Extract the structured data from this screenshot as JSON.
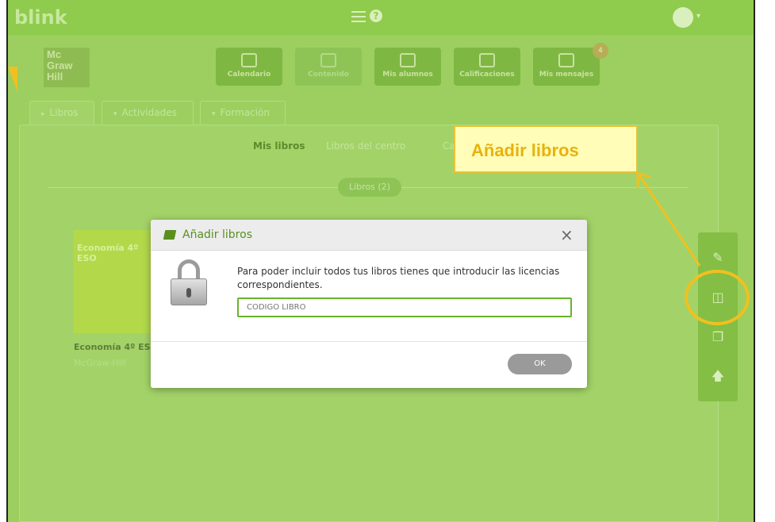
{
  "app": {
    "brand": "blink",
    "help": "?"
  },
  "logo": {
    "lines": [
      "Mc",
      "Graw",
      "Hill"
    ]
  },
  "nav": [
    {
      "label": "Calendario",
      "icon": "calendar-icon"
    },
    {
      "label": "Contenido",
      "icon": "content-icon"
    },
    {
      "label": "Mis alumnos",
      "icon": "students-icon"
    },
    {
      "label": "Calificaciones",
      "icon": "grades-icon"
    },
    {
      "label": "Mis mensajes",
      "icon": "messages-icon"
    }
  ],
  "messages_badge": "4",
  "tabs": [
    {
      "label": "Libros",
      "arrow": "▸"
    },
    {
      "label": "Actividades",
      "arrow": "▾"
    },
    {
      "label": "Formación",
      "arrow": "▾"
    }
  ],
  "subtabs": [
    "Mis libros",
    "Libros del centro",
    "Ca"
  ],
  "books_pill": "Libros (2)",
  "book": {
    "cover_text": "Economía 4º ESO",
    "title": "Economía 4º ES",
    "publisher": "McGraw-Hill"
  },
  "callout": {
    "text": "Añadir libros"
  },
  "modal": {
    "title": "Añadir libros",
    "close": "×",
    "message": "Para poder incluir todos tus libros tienes que introducir las licencias correspondientes.",
    "input_placeholder": "CÓDIGO LIBRO",
    "ok_label": "OK"
  },
  "colors": {
    "accent": "#6ab32f",
    "callout": "#e8b20d",
    "background": "#9ccf5f"
  }
}
